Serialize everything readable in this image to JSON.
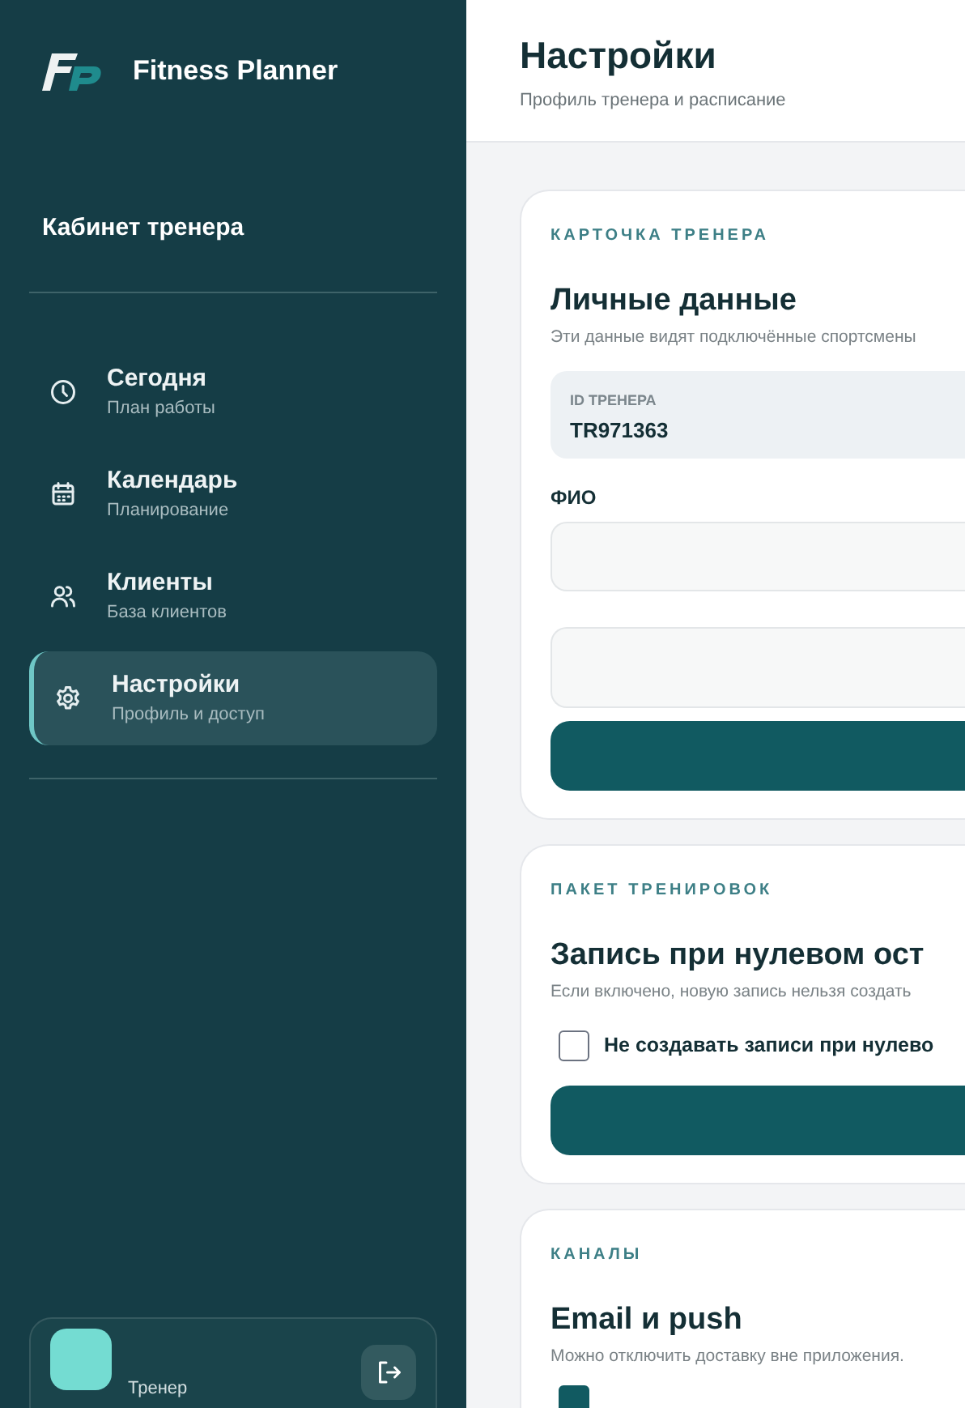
{
  "app": {
    "name": "Fitness Planner",
    "section_title": "Кабинет тренера"
  },
  "nav": [
    {
      "title": "Сегодня",
      "subtitle": "План работы",
      "selected": false
    },
    {
      "title": "Календарь",
      "subtitle": "Планирование",
      "selected": false
    },
    {
      "title": "Клиенты",
      "subtitle": "База клиентов",
      "selected": false
    },
    {
      "title": "Настройки",
      "subtitle": "Профиль и доступ",
      "selected": true
    }
  ],
  "user": {
    "role": "Тренер"
  },
  "header": {
    "title": "Настройки",
    "subtitle": "Профиль тренера и расписание"
  },
  "cards": [
    {
      "kind": "profile",
      "eyebrow": "КАРТОЧКА ТРЕНЕРА",
      "title": "Личные данные",
      "description": "Эти данные видят подключённые спортсмены",
      "id_label": "ID ТРЕНЕРА",
      "id_value": "TR971363",
      "field_label": "ФИО"
    },
    {
      "kind": "option",
      "eyebrow": "ПАКЕТ ТРЕНИРОВОК",
      "title": "Запись при нулевом ост",
      "description": "Если включено, новую запись нельзя создать",
      "checkbox": {
        "label": "Не создавать записи при нулево",
        "checked": false
      }
    },
    {
      "kind": "channels",
      "eyebrow": "КАНАЛЫ",
      "title": "Email и push",
      "description": "Можно отключить доставку вне приложения.",
      "checkbox": {
        "checked": true
      }
    }
  ]
}
